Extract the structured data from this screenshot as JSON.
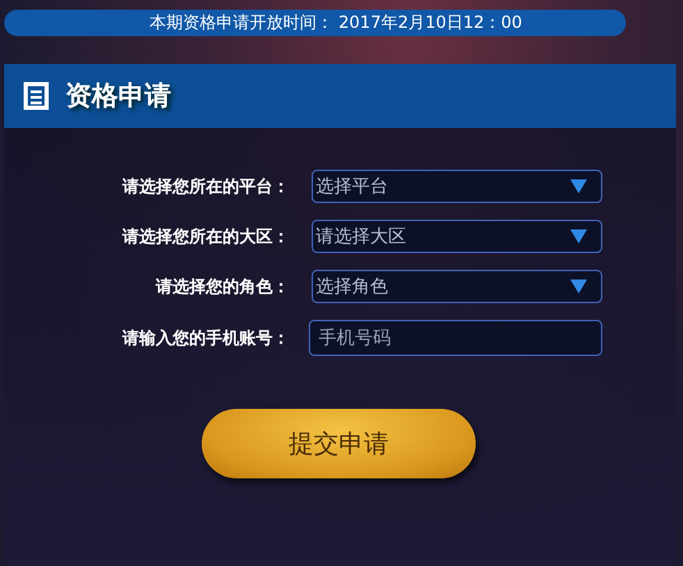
{
  "banner": {
    "text": "本期资格申请开放时间： 2017年2月10日12：00"
  },
  "panel": {
    "title": "资格申请"
  },
  "fields": [
    {
      "kind": "select",
      "label": "请选择您所在的平台：",
      "value": "选择平台"
    },
    {
      "kind": "select",
      "label": "请选择您所在的大区：",
      "value": "请选择大区"
    },
    {
      "kind": "select",
      "label": "请选择您的角色：",
      "value": "选择角色"
    },
    {
      "kind": "input",
      "label": "请输入您的手机账号：",
      "placeholder": "手机号码"
    }
  ],
  "submit": {
    "label": "提交申请"
  }
}
